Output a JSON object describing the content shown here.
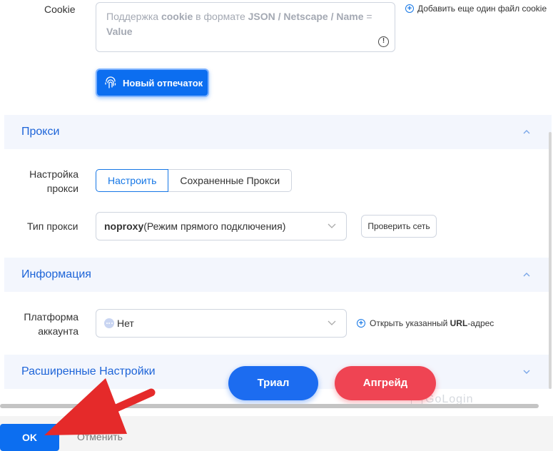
{
  "cookie": {
    "label": "Cookie",
    "placeholder_parts": [
      "Поддержка ",
      "cookie",
      " в формате ",
      "JSON / Netscape / Name",
      " = ",
      "Value"
    ],
    "add_file_label": "Добавить еще один файл cookie"
  },
  "fingerprint_button": "Новый отпечаток",
  "proxy_section": {
    "title": "Прокси",
    "settings_label_line1": "Настройка",
    "settings_label_line2": "прокси",
    "tabs": [
      "Настроить",
      "Сохраненные Прокси"
    ],
    "type_label": "Тип прокси",
    "type_value_bold": "noproxy",
    "type_value_rest": " (Режим прямого подключения)",
    "check_button": "Проверить сеть"
  },
  "info_section": {
    "title": "Информация",
    "platform_label_line1": "Платформа",
    "platform_label_line2": "аккаунта",
    "platform_value": "Нет",
    "open_url_prefix": "Открыть указанный ",
    "open_url_bold": "URL",
    "open_url_suffix": "-адрес"
  },
  "advanced_section": {
    "title": "Расширенные Настройки"
  },
  "promo": {
    "trial": "Триал",
    "upgrade": "Апгрейд"
  },
  "footer": {
    "ok": "OK",
    "cancel": "Отменить"
  },
  "watermark": "GoLogin",
  "colors": {
    "primary": "#0c6ef0",
    "section_title": "#1d64d8",
    "upgrade": "#ef4453",
    "arrow": "#e52a2a"
  },
  "icons": [
    "fingerprint-icon",
    "plus-circle-icon",
    "exclamation-icon",
    "chevron-up-icon",
    "chevron-down-icon",
    "dots-icon",
    "red-arrow"
  ]
}
